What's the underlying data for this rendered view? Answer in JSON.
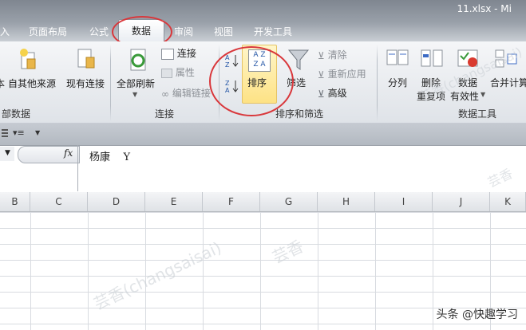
{
  "window": {
    "filename": "11.xlsx - Mi"
  },
  "tabs": [
    {
      "label": "入"
    },
    {
      "label": "页面布局"
    },
    {
      "label": "公式"
    },
    {
      "label": "数据"
    },
    {
      "label": "审阅"
    },
    {
      "label": "视图"
    },
    {
      "label": "开发工具"
    }
  ],
  "ribbon": {
    "get_external": {
      "other_sources": "自其他来源",
      "partial_left": "本",
      "existing": "现有连接",
      "group_label": "部数据"
    },
    "connections": {
      "refresh_all": "全部刷新",
      "connections": "连接",
      "properties": "属性",
      "edit_links": "编辑链接",
      "group_label": "连接"
    },
    "sort_filter": {
      "sort_az": "A Z",
      "sort_za": "Z A",
      "sort": "排序",
      "filter": "筛选",
      "clear": "清除",
      "reapply": "重新应用",
      "advanced": "高级",
      "group_label": "排序和筛选"
    },
    "data_tools": {
      "text_to_columns": "分列",
      "remove_dup_1": "删除",
      "remove_dup_2": "重复项",
      "validation_1": "数据",
      "validation_2": "有效性",
      "consolidate": "合并计算",
      "group_label": "数据工具"
    }
  },
  "formula_bar": {
    "fx": "fx",
    "content": "杨康    Y"
  },
  "columns": [
    "B",
    "C",
    "D",
    "E",
    "F",
    "G",
    "H",
    "I",
    "J",
    "K"
  ],
  "watermarks": [
    "芸香(changsaisai)",
    "芸香",
    "芸香(changsaisai)",
    "芸香"
  ],
  "footer_watermark": "头条 @快趣学习"
}
